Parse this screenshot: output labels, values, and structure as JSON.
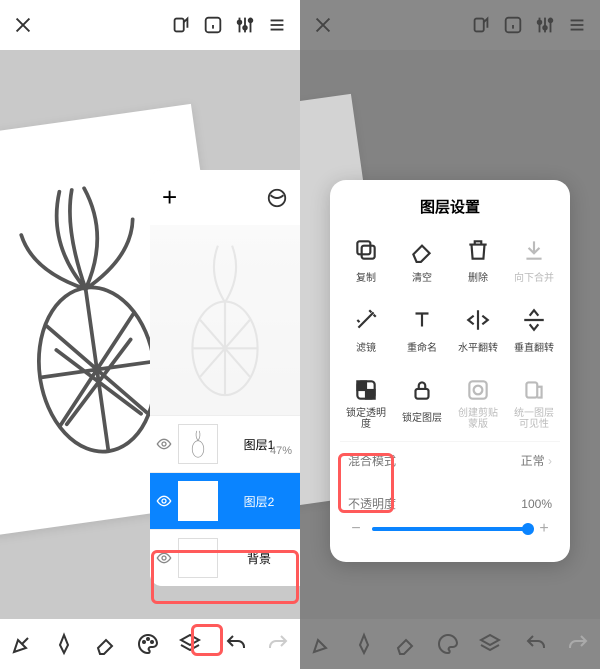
{
  "left": {
    "layers_panel": {
      "layer1": {
        "name": "图层1",
        "opacity": "47%"
      },
      "layer2": {
        "name": "图层2"
      },
      "background": {
        "name": "背景"
      }
    }
  },
  "right": {
    "settings": {
      "title": "图层设置",
      "cells": {
        "copy": "复制",
        "clear": "清空",
        "delete": "删除",
        "merge_down": "向下合并",
        "filter": "滤镜",
        "rename": "重命名",
        "flip_h": "水平翻转",
        "flip_v": "垂直翻转",
        "lock_alpha": "锁定透明度",
        "lock_layer": "锁定图层",
        "clip_mask": "创建剪贴蒙版",
        "unify_vis": "统一图层可见性"
      },
      "blend": {
        "label": "混合模式",
        "value": "正常"
      },
      "opacity": {
        "label": "不透明度",
        "value": "100%"
      }
    }
  }
}
